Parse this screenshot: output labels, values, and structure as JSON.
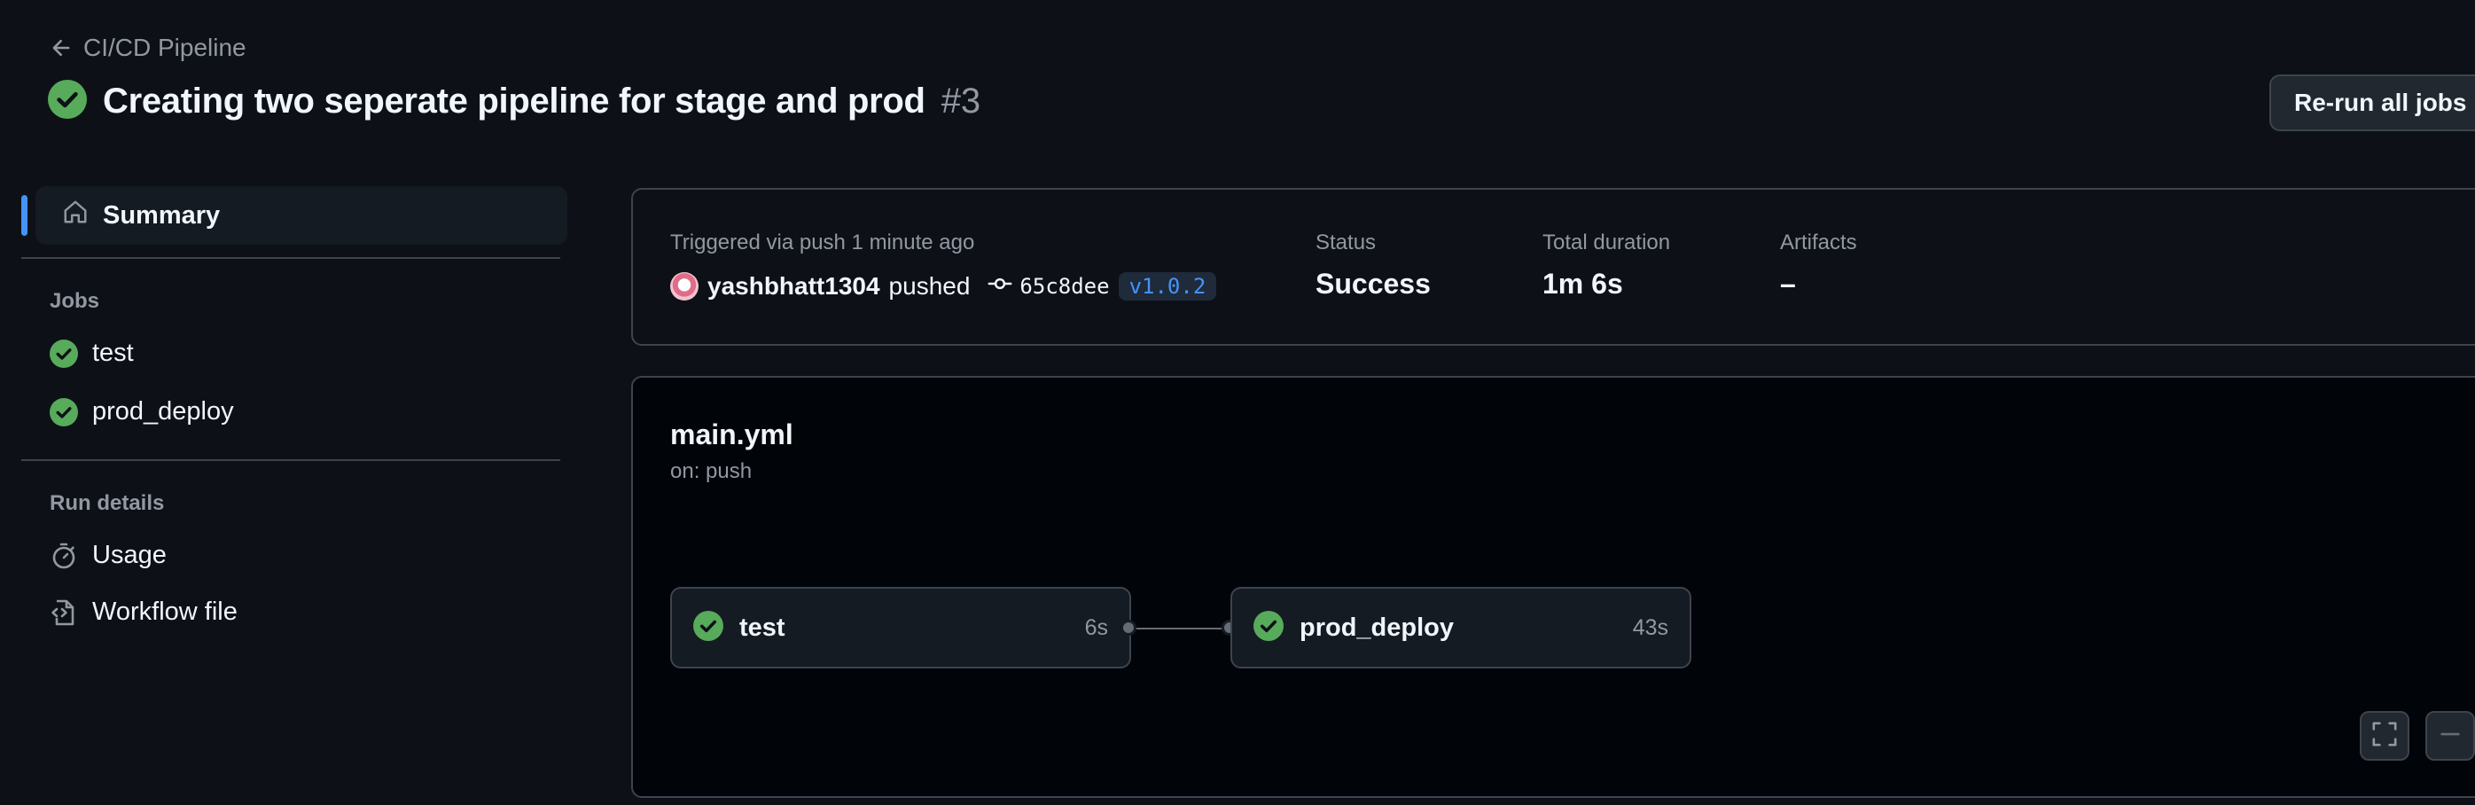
{
  "header": {
    "breadcrumb_label": "CI/CD Pipeline",
    "title": "Creating two seperate pipeline for stage and prod",
    "run_number": "#3",
    "rerun_label": "Re-run all jobs"
  },
  "sidebar": {
    "summary_label": "Summary",
    "jobs_heading": "Jobs",
    "jobs": [
      {
        "label": "test",
        "status_icon": "check-circle-icon"
      },
      {
        "label": "prod_deploy",
        "status_icon": "check-circle-icon"
      }
    ],
    "run_details_heading": "Run details",
    "run_details": [
      {
        "label": "Usage",
        "icon": "stopwatch-icon"
      },
      {
        "label": "Workflow file",
        "icon": "file-code-icon"
      }
    ]
  },
  "summary": {
    "trigger_text": "Triggered via push 1 minute ago",
    "actor": "yashbhatt1304",
    "action": "pushed",
    "commit_sha": "65c8dee",
    "tag": "v1.0.2",
    "status_label": "Status",
    "status_value": "Success",
    "duration_label": "Total duration",
    "duration_value": "1m 6s",
    "artifacts_label": "Artifacts",
    "artifacts_value": "–"
  },
  "workflow": {
    "name": "main.yml",
    "trigger": "on: push",
    "jobs": [
      {
        "name": "test",
        "duration": "6s"
      },
      {
        "name": "prod_deploy",
        "duration": "43s"
      }
    ]
  },
  "colors": {
    "background": "#0d1117",
    "success": "#57ab5a",
    "accent": "#4493f8",
    "border": "#3d444d"
  }
}
